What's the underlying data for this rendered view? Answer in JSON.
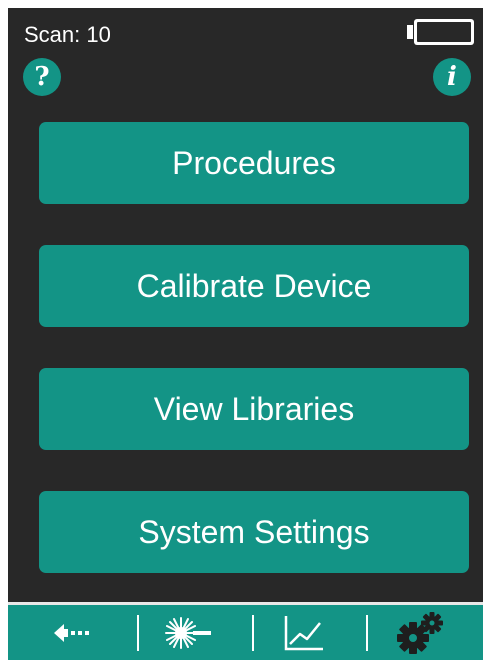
{
  "status": {
    "scan_label": "Scan: 10",
    "battery_icon": "battery-empty-icon"
  },
  "header": {
    "help_label": "?",
    "info_label": "i"
  },
  "menu": {
    "items": [
      {
        "label": "Procedures"
      },
      {
        "label": "Calibrate Device"
      },
      {
        "label": "View Libraries"
      },
      {
        "label": "System Settings"
      }
    ]
  },
  "bottom_nav": {
    "tabs": [
      {
        "icon": "back-arrow-icon"
      },
      {
        "icon": "laser-scan-icon"
      },
      {
        "icon": "chart-line-icon"
      },
      {
        "icon": "gears-icon"
      }
    ]
  },
  "colors": {
    "accent": "#139486",
    "background": "#282828",
    "text": "#ffffff"
  }
}
